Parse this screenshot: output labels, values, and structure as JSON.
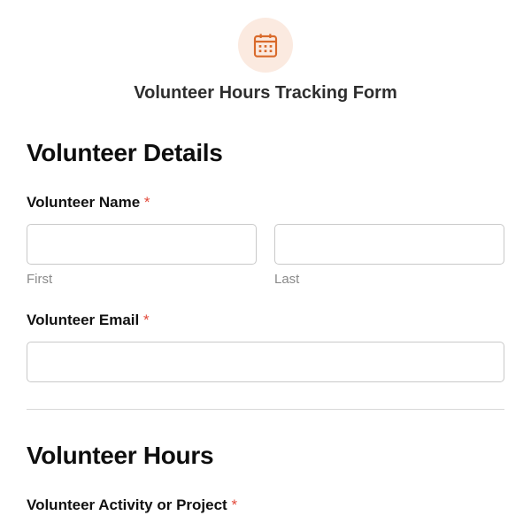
{
  "header": {
    "icon": "calendar-icon",
    "title": "Volunteer Hours Tracking Form"
  },
  "sections": {
    "details": {
      "heading": "Volunteer Details",
      "name": {
        "label": "Volunteer Name",
        "required_mark": "*",
        "first_sublabel": "First",
        "last_sublabel": "Last",
        "first_value": "",
        "last_value": ""
      },
      "email": {
        "label": "Volunteer Email",
        "required_mark": "*",
        "value": ""
      }
    },
    "hours": {
      "heading": "Volunteer Hours",
      "activity": {
        "label": "Volunteer Activity or Project",
        "required_mark": "*"
      }
    }
  }
}
